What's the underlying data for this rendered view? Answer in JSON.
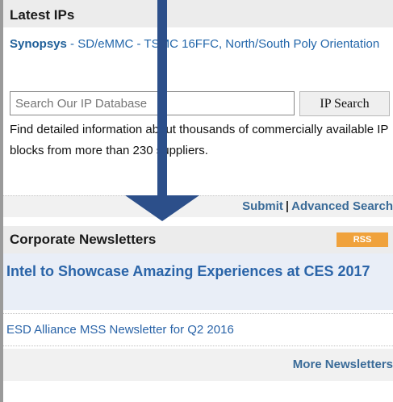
{
  "latest_ips": {
    "heading": "Latest IPs",
    "item": {
      "vendor": "Synopsys",
      "title": " - SD/eMMC - TSMC 16FFC, North/South Poly Orientation"
    }
  },
  "search": {
    "placeholder": "Search Our IP Database",
    "button_label": "IP Search",
    "description": "Find detailed information about thousands of commercially available IP blocks from more than 230 suppliers.",
    "submit_label": "Submit",
    "separator": "|",
    "advanced_label": "Advanced Search"
  },
  "newsletters": {
    "heading": "Corporate Newsletters",
    "rss_label": "RSS",
    "featured": "Intel to Showcase Amazing Experiences at CES 2017",
    "items": [
      "ESD Alliance MSS Newsletter for Q2 2016"
    ],
    "more_label": "More Newsletters"
  },
  "overlay": {
    "arrow_icon": "arrow-down-icon",
    "color": "#2c4f8a"
  }
}
